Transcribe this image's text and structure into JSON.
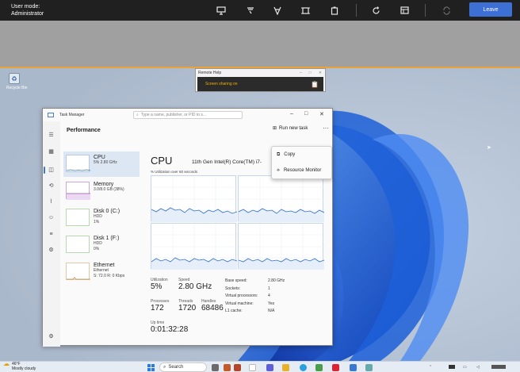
{
  "topbar": {
    "user_mode_label": "User mode:",
    "user_mode_value": "Administrator",
    "leave_label": "Leave"
  },
  "desktop": {
    "icon_label": "Recycle Bin"
  },
  "remote_help": {
    "title": "Remote Help",
    "status": "Screen sharing on"
  },
  "task_manager": {
    "title": "Task Manager",
    "search_placeholder": "Type a name, publisher, or PID to s...",
    "section_title": "Performance",
    "run_new_task": "Run new task",
    "context_menu": [
      "Copy",
      "Resource Monitor"
    ],
    "list": [
      {
        "name": "CPU",
        "sub1": "5% 2.80 GHz",
        "sub2": "",
        "sub3": ""
      },
      {
        "name": "Memory",
        "sub1": "3.0/8.0 GB (38%)",
        "sub2": "",
        "sub3": ""
      },
      {
        "name": "Disk 0 (C:)",
        "sub1": "HDD",
        "sub2": "1%",
        "sub3": ""
      },
      {
        "name": "Disk 1 (F:)",
        "sub1": "HDD",
        "sub2": "0%",
        "sub3": ""
      },
      {
        "name": "Ethernet",
        "sub1": "Ethernet",
        "sub2": "S: 72.0  R: 0 Kbps",
        "sub3": ""
      }
    ],
    "cpu": {
      "heading": "CPU",
      "model": "11th Gen Intel(R) Core(TM) i7-",
      "util_label": "% Utilization over 60 seconds",
      "stats": {
        "utilization_label": "Utilization",
        "utilization": "5%",
        "speed_label": "Speed",
        "speed": "2.80 GHz",
        "processes_label": "Processes",
        "processes": "172",
        "threads_label": "Threads",
        "threads": "1720",
        "handles_label": "Handles",
        "handles": "68486",
        "uptime_label": "Up time",
        "uptime": "0:01:32:28"
      },
      "details": [
        {
          "k": "Base speed:",
          "v": "2.80 GHz"
        },
        {
          "k": "Sockets:",
          "v": "1"
        },
        {
          "k": "Virtual processors:",
          "v": "4"
        },
        {
          "k": "Virtual machine:",
          "v": "Yes"
        },
        {
          "k": "L1 cache:",
          "v": "N/A"
        }
      ]
    }
  },
  "taskbar": {
    "temperature": "46°F",
    "weather": "Mostly cloudy",
    "search_label": "Search"
  },
  "colors": {
    "accent": "#3b78d0",
    "leave_button": "#3d6fd4",
    "share_status": "#f0b000",
    "border_highlight": "#e8a33a"
  }
}
